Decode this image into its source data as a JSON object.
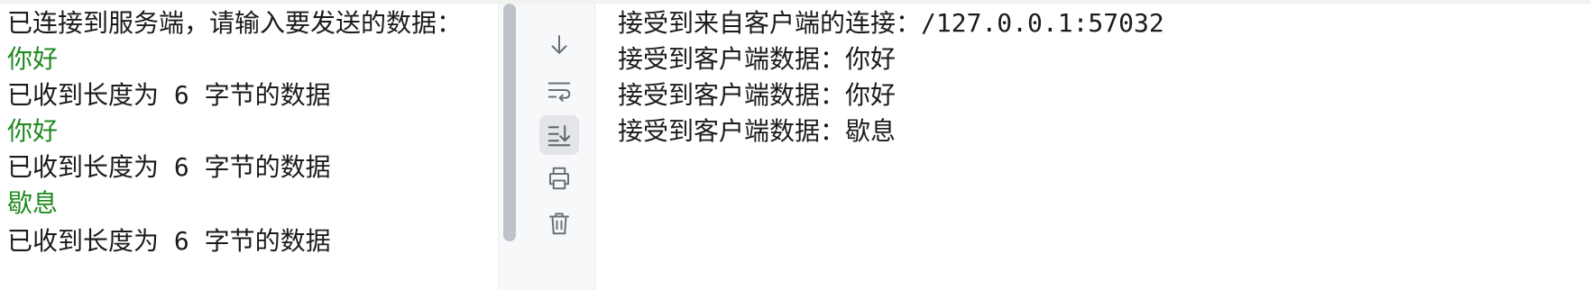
{
  "left_console": {
    "lines": [
      {
        "text": "已连接到服务端，请输入要发送的数据：",
        "kind": "output"
      },
      {
        "text": "你好",
        "kind": "input"
      },
      {
        "text": "已收到长度为 6 字节的数据",
        "kind": "output"
      },
      {
        "text": "你好",
        "kind": "input"
      },
      {
        "text": "已收到长度为 6 字节的数据",
        "kind": "output"
      },
      {
        "text": "歇息",
        "kind": "input"
      },
      {
        "text": "已收到长度为 6 字节的数据",
        "kind": "output"
      }
    ]
  },
  "toolbar": {
    "buttons": [
      {
        "icon": "scroll-down-icon",
        "active": false
      },
      {
        "icon": "soft-wrap-icon",
        "active": false
      },
      {
        "icon": "scroll-to-end-icon",
        "active": true
      },
      {
        "icon": "print-icon",
        "active": false
      },
      {
        "icon": "trash-icon",
        "active": false
      }
    ]
  },
  "right_console": {
    "lines": [
      {
        "text": "接受到来自客户端的连接：/127.0.0.1:57032"
      },
      {
        "text": "接受到客户端数据：你好"
      },
      {
        "text": "接受到客户端数据：你好"
      },
      {
        "text": "接受到客户端数据：歇息"
      }
    ]
  },
  "colors": {
    "input_text": "#1f8a1f",
    "output_text": "#1b1b1b",
    "toolbar_bg": "#f7f8fa",
    "active_button_bg": "#e3e5e9",
    "icon_stroke": "#6b7078"
  }
}
